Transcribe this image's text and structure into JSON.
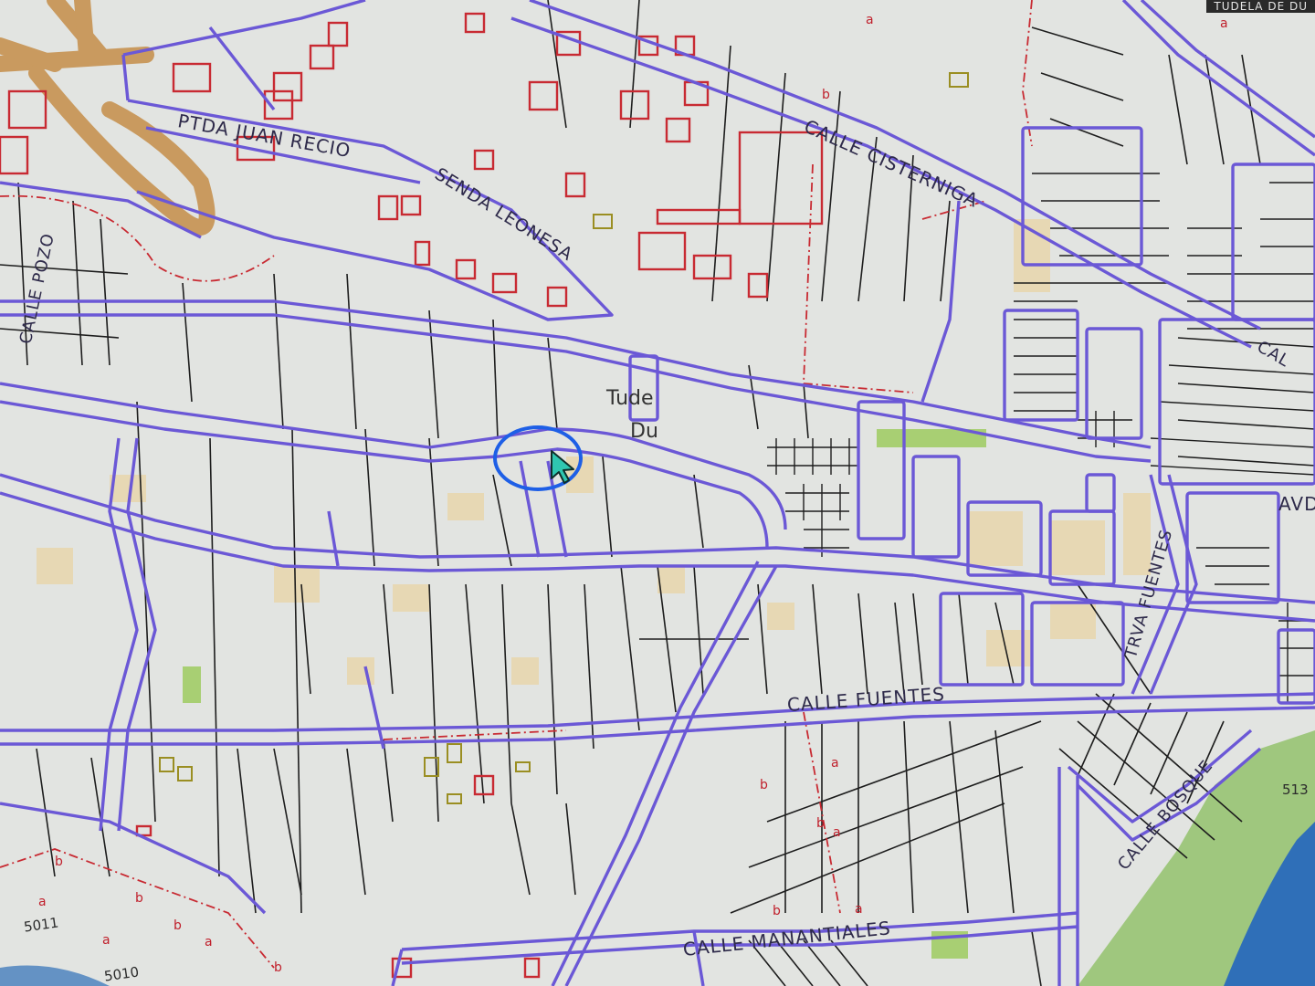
{
  "map": {
    "streets": [
      {
        "id": "pda-juan-recio",
        "label": "PTDA JUAN RECIO"
      },
      {
        "id": "senda-leonesa",
        "label": "SENDA LEONESA"
      },
      {
        "id": "calle-cisterniga",
        "label": "CALLE CISTERNIGA"
      },
      {
        "id": "calle-pozo",
        "label": "CALLE POZO"
      },
      {
        "id": "calle-fuentes",
        "label": "CALLE FUENTES"
      },
      {
        "id": "calle-manantiales",
        "label": "CALLE MANANTIALES"
      },
      {
        "id": "calle-bosque",
        "label": "CALLE BOSQUE"
      },
      {
        "id": "travia-fuentes",
        "label": "TRVA FUENTES"
      },
      {
        "id": "avda",
        "label": "AVD"
      },
      {
        "id": "cal",
        "label": "CAL"
      }
    ],
    "place_labels": {
      "tude": "Tude",
      "du": "Du"
    },
    "top_badge": "TUDELA DE DU",
    "parcel_numbers": {
      "p5011": "5011",
      "p5010": "5010",
      "p513": "513"
    },
    "lot_letters": {
      "a": "a",
      "b": "b"
    },
    "colors": {
      "background": "#e2e4e1",
      "street_outline": "#6b58d6",
      "parcel_line": "#1d1d1d",
      "building_red": "#c82a32",
      "building_fill": "#e7d8b4",
      "river": "#2f6fb8",
      "riverbank_green": "#8fbf6a",
      "highway": "#c99a5f",
      "cursor_circle": "#1e5fe6",
      "cursor_fill": "#2fc7b0"
    },
    "icons": {
      "cursor": "mouse-pointer-icon",
      "highlight": "circle-highlight"
    }
  }
}
